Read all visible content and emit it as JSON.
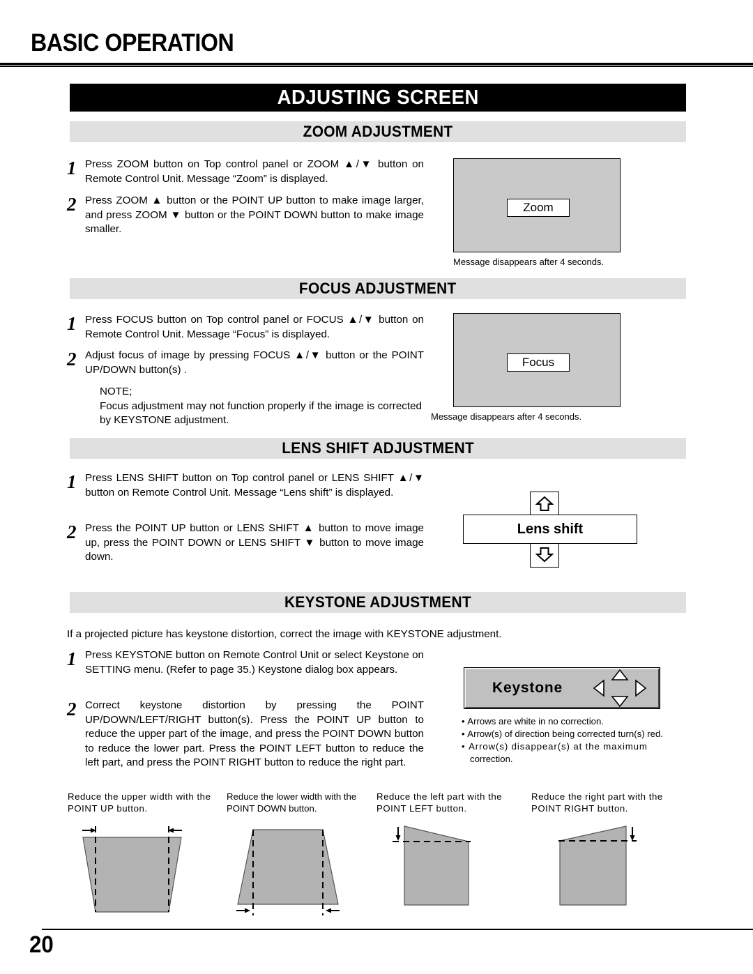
{
  "page": {
    "title": "BASIC OPERATION",
    "banner": "ADJUSTING SCREEN",
    "number": "20"
  },
  "sections": {
    "zoom": {
      "heading": "ZOOM ADJUSTMENT",
      "steps": [
        {
          "num": "1",
          "text": "Press ZOOM button on Top control panel or ZOOM ▲/▼ button on Remote Control Unit.  Message “Zoom” is displayed."
        },
        {
          "num": "2",
          "text": "Press ZOOM ▲ button or the POINT UP button to make image larger, and press ZOOM ▼ button or the POINT DOWN button to make image smaller."
        }
      ],
      "figure": {
        "message": "Zoom",
        "caption": "Message disappears after 4 seconds."
      }
    },
    "focus": {
      "heading": "FOCUS ADJUSTMENT",
      "steps": [
        {
          "num": "1",
          "text": "Press FOCUS button on Top control panel or FOCUS ▲/▼ button on Remote Control Unit.  Message “Focus” is displayed."
        },
        {
          "num": "2",
          "text": "Adjust focus of image by pressing FOCUS ▲/▼  button or the POINT UP/DOWN button(s) ."
        }
      ],
      "note_label": "NOTE;",
      "note_text": "Focus adjustment may not function properly if the image is corrected by KEYSTONE adjustment.",
      "figure": {
        "message": "Focus",
        "caption": "Message disappears after 4 seconds."
      }
    },
    "lens_shift": {
      "heading": "LENS SHIFT ADJUSTMENT",
      "steps": [
        {
          "num": "1",
          "text": "Press LENS SHIFT button on Top control panel or LENS SHIFT ▲/▼ button on Remote Control Unit. Message “Lens shift” is displayed."
        },
        {
          "num": "2",
          "text": "Press the POINT UP button or LENS SHIFT ▲ button to move image up, press the POINT DOWN or LENS SHIFT ▼ button to move image down."
        }
      ],
      "figure": {
        "message": "Lens shift"
      }
    },
    "keystone": {
      "heading": "KEYSTONE ADJUSTMENT",
      "intro": "If a projected picture has keystone distortion, correct the image with KEYSTONE adjustment.",
      "steps": [
        {
          "num": "1",
          "text": "Press KEYSTONE button on Remote Control Unit or select Keystone on SETTING menu.  (Refer to page 35.)  Keystone dialog box appears."
        },
        {
          "num": "2",
          "text": "Correct keystone distortion by pressing the POINT UP/DOWN/LEFT/RIGHT button(s).  Press the POINT UP button to reduce the upper part of the image, and press the POINT DOWN button to reduce the lower part.  Press the POINT LEFT button to reduce the left part, and press the POINT RIGHT button to reduce the right part."
        }
      ],
      "dialog": {
        "label": "Keystone"
      },
      "bullets": [
        "Arrows are white in no correction.",
        "Arrow(s) of direction being corrected turn(s) red.",
        "Arrow(s) disappear(s) at the maximum",
        "correction."
      ],
      "figures": [
        {
          "caption": "Reduce the upper width with the POINT UP button."
        },
        {
          "caption": "Reduce the lower width with the POINT DOWN button."
        },
        {
          "caption": "Reduce the left part with the POINT LEFT button."
        },
        {
          "caption": "Reduce the right part with the POINT RIGHT button."
        }
      ]
    }
  },
  "colors": {
    "banner_bg": "#000000",
    "section_bar_bg": "#e0e0e0",
    "screen_gray": "#c9c9c9",
    "dialog_gray": "#c0c0c0",
    "figure_gray": "#b3b3b3"
  }
}
